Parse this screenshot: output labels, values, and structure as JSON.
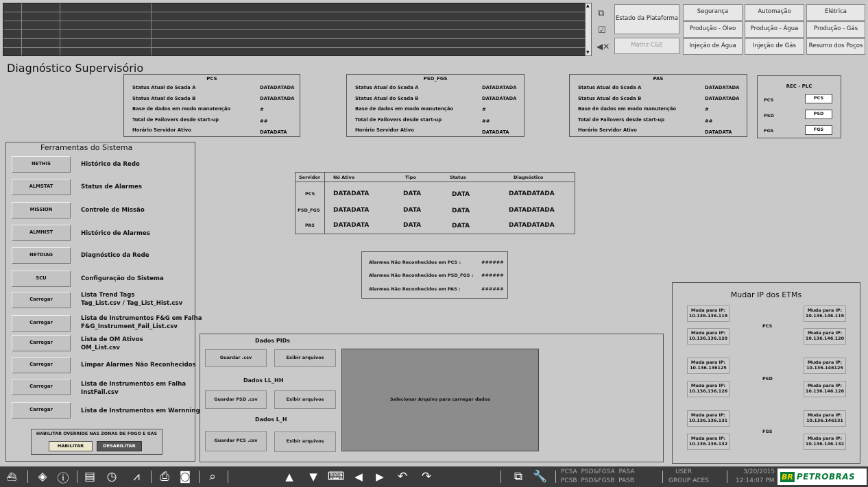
{
  "nav": {
    "estado": "Estado da Plataforma",
    "matriz": "Matriz C&E",
    "seguranca": "Segurança",
    "automacao": "Automação",
    "eletrica": "Elétrica",
    "prod_oleo": "Produção - Óleo",
    "prod_agua": "Produção - Água",
    "prod_gas": "Produção - Gás",
    "inj_agua": "Injeção de Água",
    "inj_gas": "Injeção de Gás",
    "resumo": "Resumo dos Poços"
  },
  "page_title": "Diagnóstico Supervisório",
  "status_panels": [
    {
      "title": "PCS",
      "rows": [
        {
          "label": "Status Atual do Scada A",
          "value": "DATADATADA"
        },
        {
          "label": "Status Atual do Scada B",
          "value": "DATADATADA"
        },
        {
          "label": "Base de dados em modo manutenção",
          "value": "#"
        },
        {
          "label": "Total de Failovers desde start-up",
          "value": "##"
        },
        {
          "label": "Horário Servidor Ativo",
          "value": "DATADATA"
        }
      ]
    },
    {
      "title": "PSD_FGS",
      "rows": [
        {
          "label": "Status Atual do Scada A",
          "value": "DATADATADA"
        },
        {
          "label": "Status Atual do Scada B",
          "value": "DATADATADA"
        },
        {
          "label": "Base de dados em modo manutenção",
          "value": "#"
        },
        {
          "label": "Total de Failovers desde start-up",
          "value": "##"
        },
        {
          "label": "Horário Servidor Ativo",
          "value": "DATADATA"
        }
      ]
    },
    {
      "title": "PAS",
      "rows": [
        {
          "label": "Status Atual do Scada A",
          "value": "DATADATADA"
        },
        {
          "label": "Status Atual do Scada B",
          "value": "DATADATADA"
        },
        {
          "label": "Base de dados em modo manutenção",
          "value": "#"
        },
        {
          "label": "Total de Failovers desde start-up",
          "value": "##"
        },
        {
          "label": "Horário Servidor Ativo",
          "value": "DATADATA"
        }
      ]
    }
  ],
  "rec_plc": {
    "title": "REC - PLC",
    "rows": [
      {
        "label": "PCS",
        "button": "PCS"
      },
      {
        "label": "PSD",
        "button": "PSD"
      },
      {
        "label": "FGS",
        "button": "FGS"
      }
    ]
  },
  "tools": {
    "title": "Ferramentas do Sistema",
    "items": [
      {
        "button": "NETHIS",
        "label": "Histórico da Rede"
      },
      {
        "button": "ALMSTAT",
        "label": "Status de Alarmes"
      },
      {
        "button": "MISSION",
        "label": "Controle de Missão"
      },
      {
        "button": "ALMHIST",
        "label": "Histórico de Alarmes"
      },
      {
        "button": "NETDIAG",
        "label": "Diagnóstico da Rede"
      },
      {
        "button": "SCU",
        "label": "Configuração do Sistema"
      },
      {
        "button": "Carregar",
        "label": "Lista Trend Tags",
        "label2": "Tag_List.csv / Tag_List_Hist.csv"
      },
      {
        "button": "Carregar",
        "label": "Lista de Instrumentos F&G em Falha",
        "label2": "F&G_Instrument_Fail_List.csv"
      },
      {
        "button": "Carregar",
        "label": "Lista de OM Ativos",
        "label2": "OM_List.csv"
      },
      {
        "button": "Carregar",
        "label": "Limpar Alarmes Não Reconhecidos"
      },
      {
        "button": "Carregar",
        "label": "Lista de Instrumentos em Falha",
        "label2": "InstFail.csv"
      },
      {
        "button": "Carregar",
        "label": "Lista de Instrumentos em Warnning"
      }
    ],
    "override_title": "HABILITAR OVERRIDE NAS ZONAS DE FOGO E GAS",
    "habilitar": "HABILITAR",
    "desabilitar": "DESABILITAR"
  },
  "servers": {
    "headers": [
      "Servidor",
      "Nó Ativo",
      "Tipo",
      "Status",
      "Diagnóstico"
    ],
    "rows": [
      {
        "server": "PCS",
        "node": "DATADATA",
        "type": "DATA",
        "status": "DATA",
        "diag": "DATADATADA"
      },
      {
        "server": "PSD_FGS",
        "node": "DATADATA",
        "type": "DATA",
        "status": "DATA",
        "diag": "DATADATADA"
      },
      {
        "server": "PAS",
        "node": "DATADATA",
        "type": "DATA",
        "status": "DATA",
        "diag": "DATADATADA"
      }
    ]
  },
  "alarms": [
    {
      "label": "Alarmes Não Reconhecidos em PCS :",
      "value": "######"
    },
    {
      "label": "Alarmes Não Reconhecidos em PSD_FGS :",
      "value": "######"
    },
    {
      "label": "Alarmes Não Reconhecidos em PAS :",
      "value": "######"
    }
  ],
  "dados": {
    "pids_title": "Dados PIDs",
    "pids_save": "Guardar .csv",
    "pids_show": "Exibir arquivos",
    "llhh_title": "Dados LL_HH",
    "llhh_save": "Guardar PSD .csv",
    "llhh_show": "Exibir arquivos",
    "lh_title": "Dados L_H",
    "lh_save": "Guardar PCS .csv",
    "lh_show": "Exibir arquivos",
    "placeholder": "Selecionar Arquivo para carregar dados"
  },
  "etm": {
    "title": "Mudar IP dos ETMs",
    "groups": [
      {
        "label": "PCS",
        "left": [
          {
            "t": "Muda para IP:",
            "ip": "10.136.136.119"
          },
          {
            "t": "Muda para IP:",
            "ip": "10.136.136.120"
          }
        ],
        "right": [
          {
            "t": "Muda para IP:",
            "ip": "10.136.146.119"
          },
          {
            "t": "Muda para IP:",
            "ip": "10.136.146.120"
          }
        ]
      },
      {
        "label": "PSD",
        "left": [
          {
            "t": "Muda para IP:",
            "ip": "10.136.136125"
          },
          {
            "t": "Muda para IP:",
            "ip": "10.136.136.126"
          }
        ],
        "right": [
          {
            "t": "Muda para IP:",
            "ip": "10.136.146125"
          },
          {
            "t": "Muda para IP:",
            "ip": "10.136.146.126"
          }
        ]
      },
      {
        "label": "FGS",
        "left": [
          {
            "t": "Muda para IP:",
            "ip": "10.136.136.131"
          },
          {
            "t": "Muda para IP:",
            "ip": "10.136.136.132"
          }
        ],
        "right": [
          {
            "t": "Muda para IP:",
            "ip": "10.136.146131"
          },
          {
            "t": "Muda para IP:",
            "ip": "10.136.146.132"
          }
        ]
      }
    ]
  },
  "statusbar": {
    "line1": "PCSA  PSD&FGSA  PASA",
    "line2": "PCSB  PSD&FGSB  PASB",
    "user": "USER",
    "group": "GROUP ACES",
    "date": "3/20/2015",
    "time": "12:14:07 PM",
    "logo_br": "BR",
    "logo_text": "PETROBRAS"
  },
  "colors": {
    "toolbar_bg": "#3b3b3b",
    "logo_green": "#0a7a3b",
    "logo_yellow": "#f5d800",
    "panel_bg": "#c9c9c9",
    "data_area": "#8c8c8c"
  }
}
